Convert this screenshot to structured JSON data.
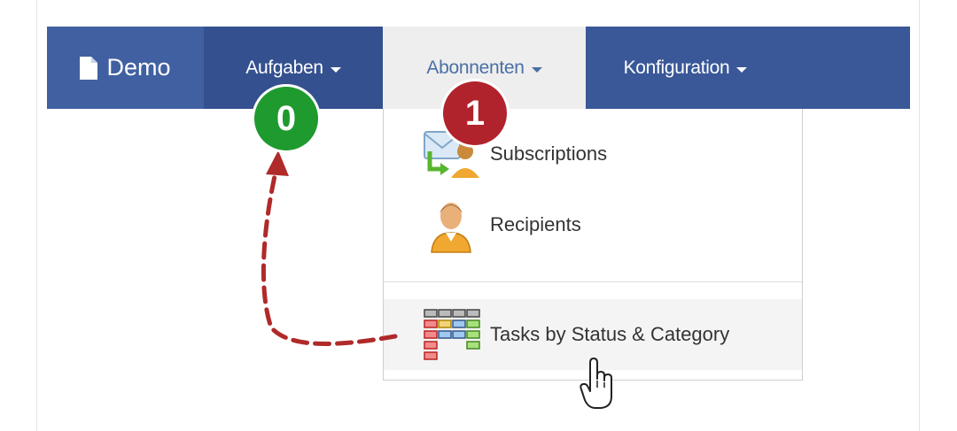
{
  "navbar": {
    "brand": "Demo",
    "items": [
      {
        "label": "Aufgaben"
      },
      {
        "label": "Abonnenten"
      },
      {
        "label": "Konfiguration"
      }
    ]
  },
  "dropdown": {
    "items": [
      {
        "label": "Subscriptions",
        "icon": "subscriptions-icon"
      },
      {
        "label": "Recipients",
        "icon": "user-icon"
      },
      {
        "label": "Tasks by Status & Category",
        "icon": "task-grid-icon"
      }
    ]
  },
  "annotations": {
    "step_badges": [
      {
        "number": "0",
        "color": "#1f9a2e"
      },
      {
        "number": "1",
        "color": "#b1232c"
      }
    ],
    "arrow_color": "#b02a2a"
  },
  "colors": {
    "navbar": "#3a5898",
    "active_tab": "#eeeeee"
  }
}
